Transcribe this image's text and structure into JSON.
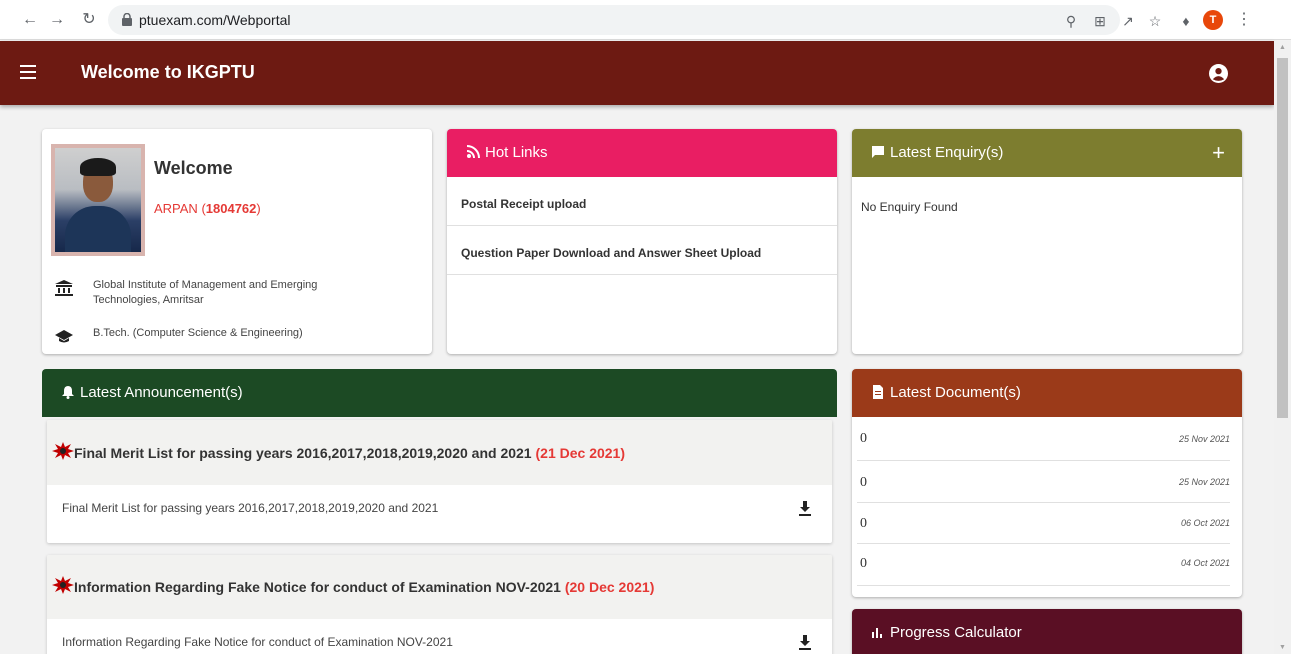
{
  "browser": {
    "url": "ptuexam.com/Webportal",
    "profile_initial": "T"
  },
  "appbar": {
    "title": "Welcome to IKGPTU"
  },
  "welcome": {
    "heading": "Welcome",
    "student_name": "ARPAN",
    "roll_open": " (",
    "roll_no": "1804762",
    "roll_close": ")",
    "institute": "Global Institute of Management and Emerging Technologies, Amritsar",
    "course": "B.Tech. (Computer Science & Engineering)"
  },
  "hot_links": {
    "title": "Hot Links",
    "items": [
      {
        "label": "Postal Receipt upload"
      },
      {
        "label": "Question Paper Download and Answer Sheet Upload"
      }
    ]
  },
  "enquiry": {
    "title": "Latest Enquiry(s)",
    "add_label": "+",
    "empty_text": "No Enquiry Found"
  },
  "announcements": {
    "title": "Latest Announcement(s)",
    "items": [
      {
        "title": "Final Merit List for passing years 2016,2017,2018,2019,2020 and 2021",
        "date": "(21 Dec 2021)",
        "body": "Final Merit List for passing years 2016,2017,2018,2019,2020 and 2021"
      },
      {
        "title": "Information Regarding Fake Notice for conduct of Examination NOV-2021",
        "date": "(20 Dec 2021)",
        "body": "Information Regarding Fake Notice for conduct of Examination NOV-2021"
      }
    ]
  },
  "documents": {
    "title": "Latest Document(s)",
    "items": [
      {
        "value": "0",
        "date": "25 Nov 2021"
      },
      {
        "value": "0",
        "date": "25 Nov 2021"
      },
      {
        "value": "0",
        "date": "06 Oct 2021"
      },
      {
        "value": "0",
        "date": "04 Oct 2021"
      }
    ]
  },
  "progress": {
    "title": "Progress Calculator"
  },
  "colors": {
    "appbar": "#6d1a12",
    "hot_links": "#e91e63",
    "enquiry": "#7d7d2f",
    "announcements": "#1c4a24",
    "documents": "#9b3a19",
    "progress": "#5a0f24",
    "date_red": "#e53935"
  }
}
